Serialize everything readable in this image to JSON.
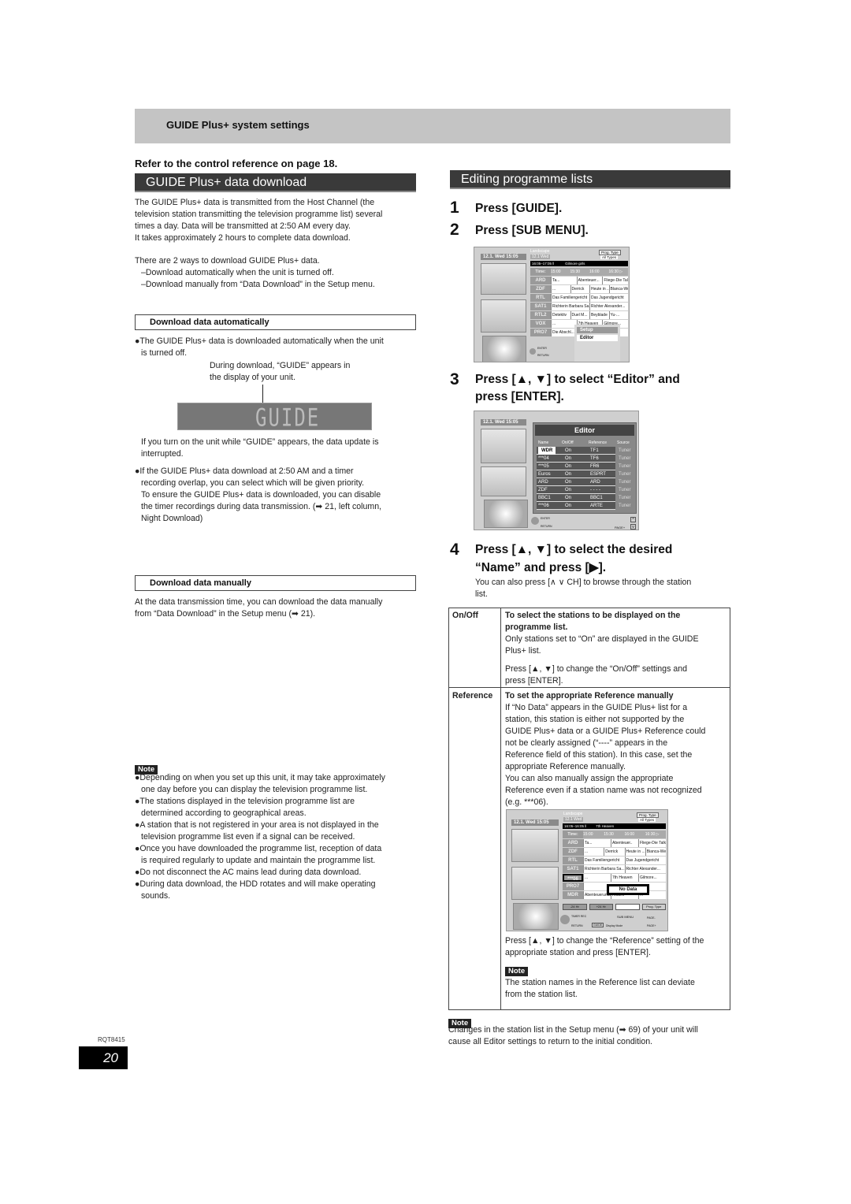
{
  "header": {
    "section_label": "GUIDE Plus+ system settings",
    "control_reference": "Refer to the control reference on page 18."
  },
  "left": {
    "title": "GUIDE Plus+ data download",
    "intro": [
      "The GUIDE Plus+ data is transmitted from the Host Channel (the",
      "television station transmitting the television programme list) several",
      "times a day. Data will be transmitted at 2:50 AM every day.",
      "It takes approximately 2 hours to complete data download."
    ],
    "ways_intro": "There are 2 ways to download GUIDE Plus+ data.",
    "ways": [
      "–Download automatically when the unit is turned off.",
      "–Download manually from “Data Download” in the Setup menu."
    ],
    "auto": {
      "heading": "Download data automatically",
      "bullet1": [
        "●The GUIDE Plus+ data is downloaded automatically when the unit",
        "is turned off."
      ],
      "callout": [
        "During download, “GUIDE” appears in",
        "the display of your unit."
      ],
      "display_text": "GUIDE",
      "interrupt": [
        "If you turn on the unit while “GUIDE” appears, the data update is",
        "interrupted."
      ],
      "bullet2": [
        "●If the GUIDE Plus+ data download at 2:50 AM and a timer",
        "recording overlap, you can select which will be given priority.",
        "To ensure the GUIDE Plus+ data is downloaded, you can disable",
        "the timer recordings during data transmission. (➡ 21, left column,",
        "Night Download)"
      ]
    },
    "manual": {
      "heading": "Download data manually",
      "text": [
        "At the data transmission time, you can download the data manually",
        "from “Data Download” in the Setup menu (➡ 21)."
      ]
    },
    "note": {
      "tag": "Note",
      "items": [
        [
          "●Depending on when you set up this unit, it may take approximately",
          "one day before you can display the television programme list."
        ],
        [
          "●The stations displayed in the television programme list are",
          "determined according to geographical areas."
        ],
        [
          "●A station that is not registered in your area is not displayed in the",
          "television programme list even if a signal can be received."
        ],
        [
          "●Once you have downloaded the programme list, reception of data",
          "is required regularly to update and maintain the programme list."
        ],
        [
          "●Do not disconnect the AC mains lead during data download."
        ],
        [
          "●During data download, the HDD rotates and will make operating",
          "sounds."
        ]
      ]
    }
  },
  "right": {
    "title": "Editing programme lists",
    "steps": [
      {
        "num": "1",
        "text": "Press [GUIDE]."
      },
      {
        "num": "2",
        "text": "Press [SUB MENU]."
      },
      {
        "num": "3",
        "text": [
          "Press [▲, ▼] to select “Editor” and",
          "press [ENTER]."
        ]
      },
      {
        "num": "4",
        "text": [
          "Press [▲, ▼] to select the desired",
          "“Name” and press [▶]."
        ]
      }
    ],
    "step4_hint": [
      "You can also press [∧  ∨ CH] to browse through the station",
      "list."
    ],
    "table": [
      {
        "key": "On/Off",
        "heading": [
          "To select the stations to be displayed on the",
          "programme list."
        ],
        "body": [
          "Only stations set to “On” are displayed in the GUIDE",
          "Plus+ list."
        ],
        "body2": [
          "Press [▲, ▼] to change the “On/Off” settings and",
          "press [ENTER]."
        ]
      },
      {
        "key": "Reference",
        "heading": [
          "To set the appropriate Reference manually"
        ],
        "body": [
          "If “No Data” appears in the GUIDE Plus+ list for a",
          "station, this station is either not supported by the",
          "GUIDE Plus+ data or a GUIDE Plus+ Reference could",
          "not be clearly assigned (“----” appears in the",
          "Reference field of this station). In this case, set the",
          "appropriate Reference manually.",
          "You can also manually assign the appropriate",
          "Reference even if a station name was not recognized",
          "(e.g. ***06)."
        ],
        "body2": [
          "Press [▲, ▼] to change the “Reference” setting of the",
          "appropriate station and press [ENTER]."
        ],
        "note_tag": "Note",
        "note": [
          "The station names in the Reference list can deviate",
          "from the station list."
        ]
      }
    ],
    "note": {
      "tag": "Note",
      "text": [
        "Changes in the station list in the Setup menu (➡ 69) of your unit will",
        "cause all Editor settings to return to the initial condition."
      ]
    }
  },
  "screens": {
    "clock": "12.1. Wed   15:05",
    "guide": {
      "mode": "Landscape",
      "date": "12.1 Wed",
      "prog_type_label": "Prog. Type",
      "prog_type_value": "All Types",
      "now_time": "16:05–17:05 ‖",
      "now_title": "Gilmore girls",
      "time_label": "Time:",
      "times": [
        "15:00",
        "15:30",
        "16:00",
        "16:30 ▷"
      ],
      "rows": [
        {
          "ch": "ARD",
          "cells": [
            "Ta...",
            "Abenteuer...",
            "Fliege-Die Talkshow"
          ]
        },
        {
          "ch": "ZDF",
          "cells": [
            "...",
            "Derrick",
            "Heute in ...",
            "Blanca-Wege..."
          ]
        },
        {
          "ch": "RTL",
          "cells": [
            "Das Familiengericht",
            "Das Jugendgericht"
          ]
        },
        {
          "ch": "SAT1",
          "cells": [
            "Richterin Barbara Sa...",
            "Richter Alexander..."
          ]
        },
        {
          "ch": "RTL2",
          "cells": [
            "Detektiv",
            "Duel M...",
            "Beyblade",
            "Yu-..."
          ]
        },
        {
          "ch": "VOX",
          "cells": [
            "...",
            "7th Heaven",
            "Gilmore..."
          ]
        },
        {
          "ch": "PRO7",
          "cells": [
            "Die Abschl...",
            "",
            "..."
          ]
        }
      ],
      "menu": [
        "Setup",
        "Editor"
      ],
      "enter": "ENTER",
      "return": "RETURN"
    },
    "editor": {
      "title": "Editor",
      "columns": [
        "Name",
        "On/Off",
        "Reference",
        "Source"
      ],
      "rows": [
        {
          "name": "WDR",
          "on": "On",
          "ref": "TF1",
          "src": "Tuner"
        },
        {
          "name": "***04",
          "on": "On",
          "ref": "TF6",
          "src": "Tuner"
        },
        {
          "name": "***05",
          "on": "On",
          "ref": "FR6",
          "src": "Tuner"
        },
        {
          "name": "Euros",
          "on": "On",
          "ref": "ESPRT",
          "src": "Tuner"
        },
        {
          "name": "ARD",
          "on": "On",
          "ref": "ARD",
          "src": "Tuner"
        },
        {
          "name": "ZDF",
          "on": "On",
          "ref": "- - - -",
          "src": "Tuner"
        },
        {
          "name": "BBC1",
          "on": "On",
          "ref": "BBC1",
          "src": "Tuner"
        },
        {
          "name": "***06",
          "on": "On",
          "ref": "ARTE",
          "src": "Tuner"
        }
      ],
      "page": "PAGE+",
      "enter": "ENTER",
      "return": "RETURN"
    },
    "nodata": {
      "now_time": "16:05–16:05 ‖",
      "now_title": "7th Heaven",
      "rows": [
        {
          "ch": "ARD",
          "cells": [
            "Ta...",
            "Abenteuer..",
            "Fliege-Die Talkshow"
          ]
        },
        {
          "ch": "ZDF",
          "cells": [
            "...",
            "Derrick",
            "Heute in ...",
            "Bianca-Wege.."
          ]
        },
        {
          "ch": "RTL",
          "cells": [
            "Das Familiengericht",
            "Das Jugendgericht"
          ]
        },
        {
          "ch": "SAT1",
          "cells": [
            "Richterin Barbara Sa...",
            "Richter Alexander..."
          ]
        },
        {
          "ch": "***06",
          "cells": [
            "...",
            "7th Heaven",
            "Gilmore..."
          ]
        },
        {
          "ch": "PRO7",
          "cells": [
            ""
          ]
        },
        {
          "ch": "MDR",
          "cells": [
            "Abenteuerurlaub",
            "Aktuell",
            "..."
          ]
        }
      ],
      "popup": "No Data",
      "buttons": [
        "-24 Hr",
        "+24 Hr",
        "",
        "Prog. Type"
      ],
      "timer_rec": "TIMER REC",
      "sub_menu": "SUB MENU",
      "guide_btn": "GUIDE",
      "display_mode": "Display Mode",
      "page_minus": "PAGE-",
      "page_plus": "PAGE+",
      "return": "RETURN"
    }
  },
  "footer": {
    "doc_code": "RQT8415",
    "page_number": "20"
  }
}
